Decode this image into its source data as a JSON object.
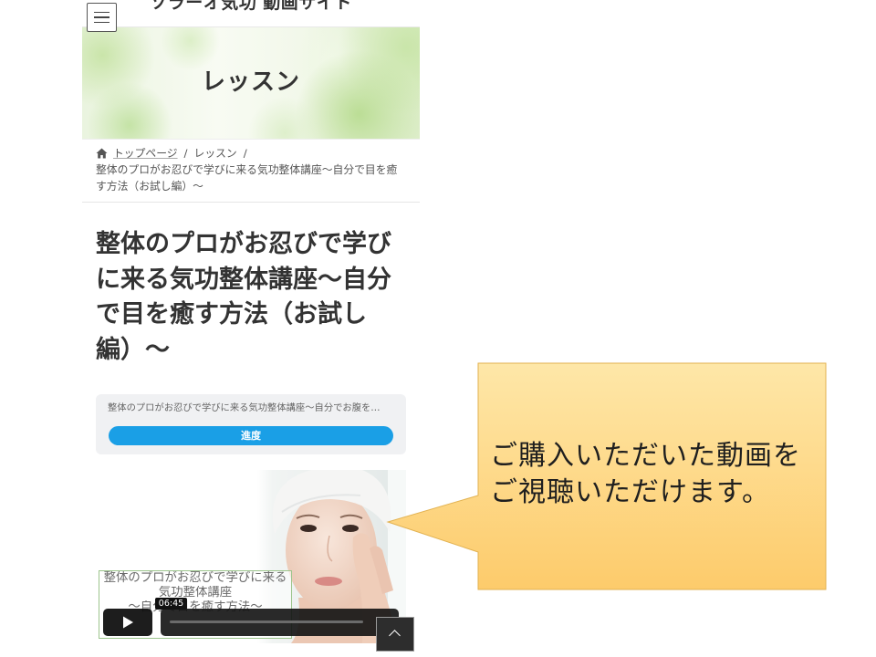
{
  "site": {
    "header": {
      "title": "ソラーオ気功 動画サイト",
      "menu_icon": "hamburger-menu-icon"
    },
    "banner": {
      "title": "レッスン"
    },
    "breadcrumb": {
      "home_icon": "home-icon",
      "separator": "/",
      "items": [
        "トップページ",
        "レッスン"
      ],
      "current": "整体のプロがお忍びで学びに来る気功整体講座〜自分で目を癒す方法（お試し編）〜"
    },
    "lesson": {
      "title": "整体のプロがお忍びで学びに来る気功整体講座〜自分で目を癒す方法（お試し編）〜",
      "progress_card": {
        "course_name": "整体のプロがお忍びで学びに来る気功整体講座〜自分でお腹を…",
        "button_label": "進度"
      },
      "video": {
        "overlay_lines": [
          "整体のプロがお忍びで学びに来る",
          "気功整体講座",
          "〜自分で目を癒す方法〜"
        ],
        "time_tooltip": "06:45",
        "play_icon": "play-icon",
        "volume_icon": "volume-icon"
      }
    },
    "back_to_top_icon": "chevron-up-icon"
  },
  "slide": {
    "callout": {
      "text": "ご購入いただいた動画をご視聴いただけます。"
    }
  },
  "colors": {
    "progress_button": "#1a9fe6",
    "callout_fill_top": "#fee7a8",
    "callout_fill_bottom": "#fdcb6b",
    "callout_border": "#e2b251",
    "text_dark": "#333333"
  }
}
